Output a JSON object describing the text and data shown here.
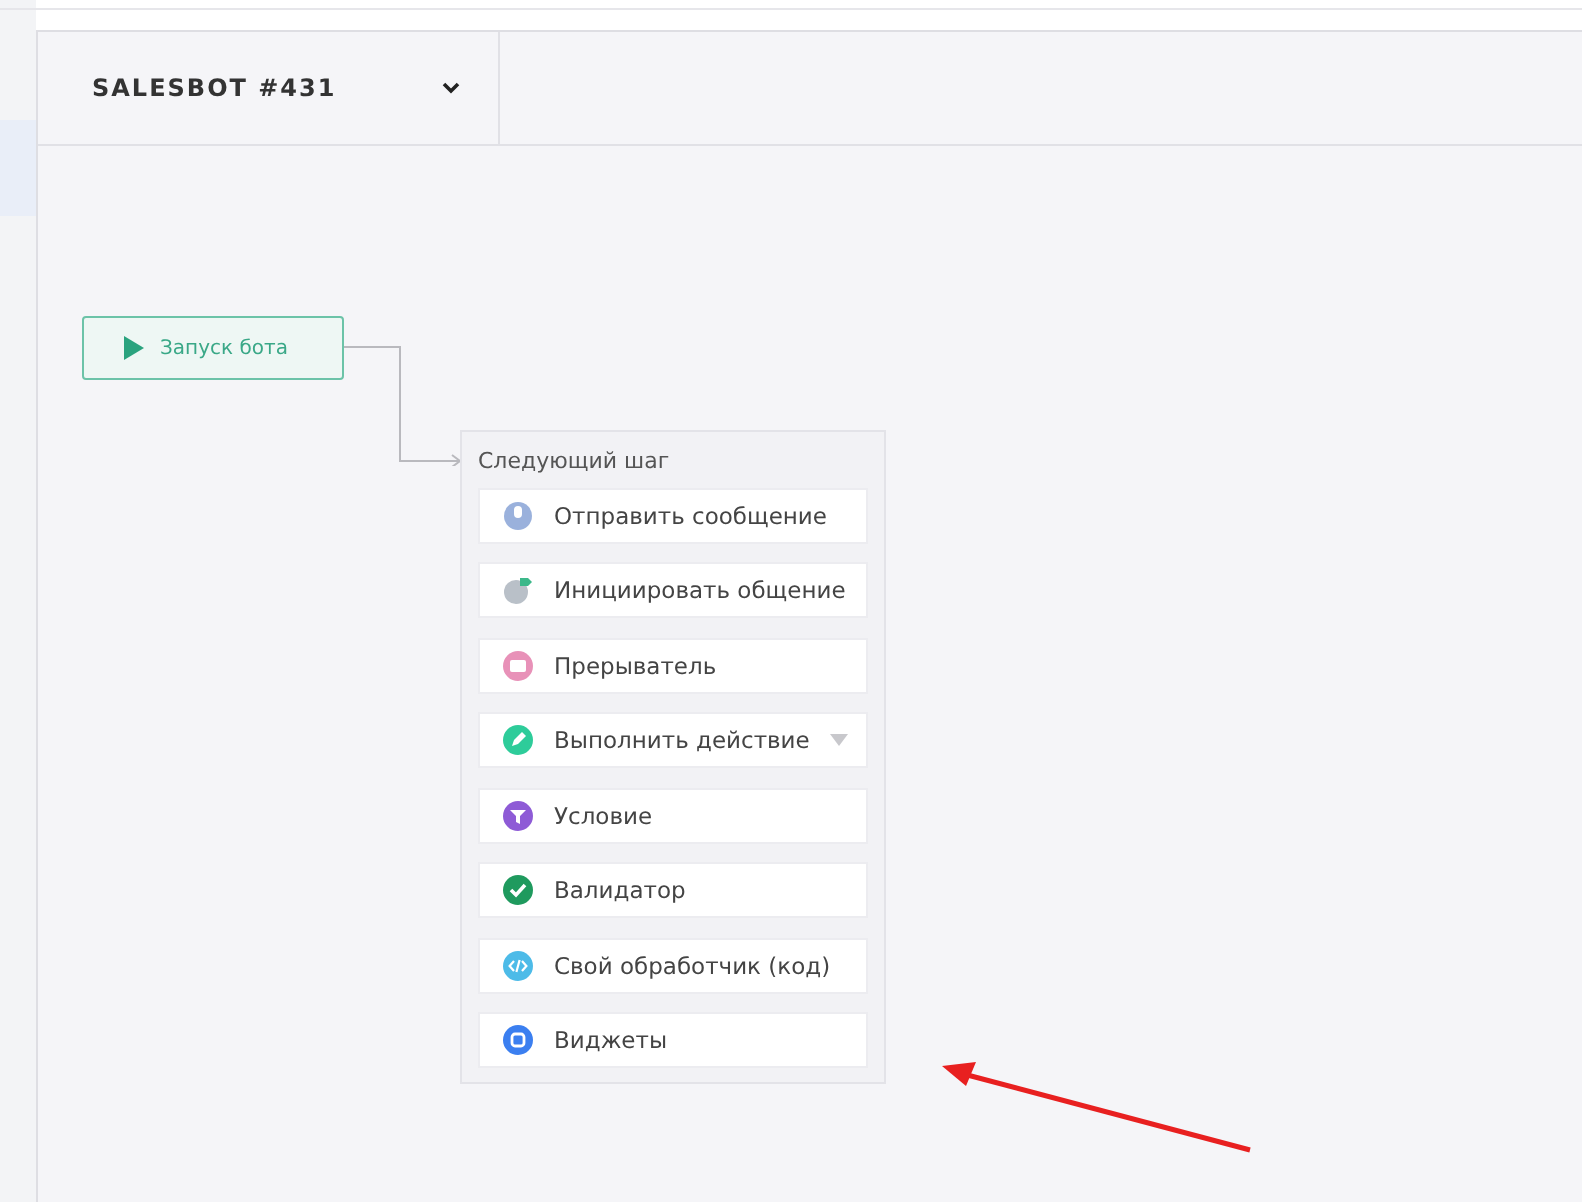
{
  "header": {
    "title": "SALESBOT #431",
    "dropdown_expanded": false
  },
  "canvas": {
    "start_node": {
      "label": "Запуск бота"
    },
    "next_step": {
      "title": "Следующий шаг",
      "items": [
        {
          "label": "Отправить сообщение",
          "kind": "message",
          "color": "#8fa8d8",
          "has_submenu": false
        },
        {
          "label": "Инициировать общение",
          "kind": "initiate",
          "color": "#b9c0c8",
          "has_submenu": false
        },
        {
          "label": "Прерыватель",
          "kind": "breaker",
          "color": "#e891b8",
          "has_submenu": false
        },
        {
          "label": "Выполнить действие",
          "kind": "action",
          "color": "#2ecc9a",
          "has_submenu": true
        },
        {
          "label": "Условие",
          "kind": "condition",
          "color": "#8e5bd6",
          "has_submenu": false
        },
        {
          "label": "Валидатор",
          "kind": "validator",
          "color": "#1f9a5e",
          "has_submenu": false
        },
        {
          "label": "Свой обработчик (код)",
          "kind": "code",
          "color": "#4dbbe8",
          "has_submenu": false
        },
        {
          "label": "Виджеты",
          "kind": "widget",
          "color": "#3b7ff0",
          "has_submenu": false
        }
      ]
    }
  }
}
